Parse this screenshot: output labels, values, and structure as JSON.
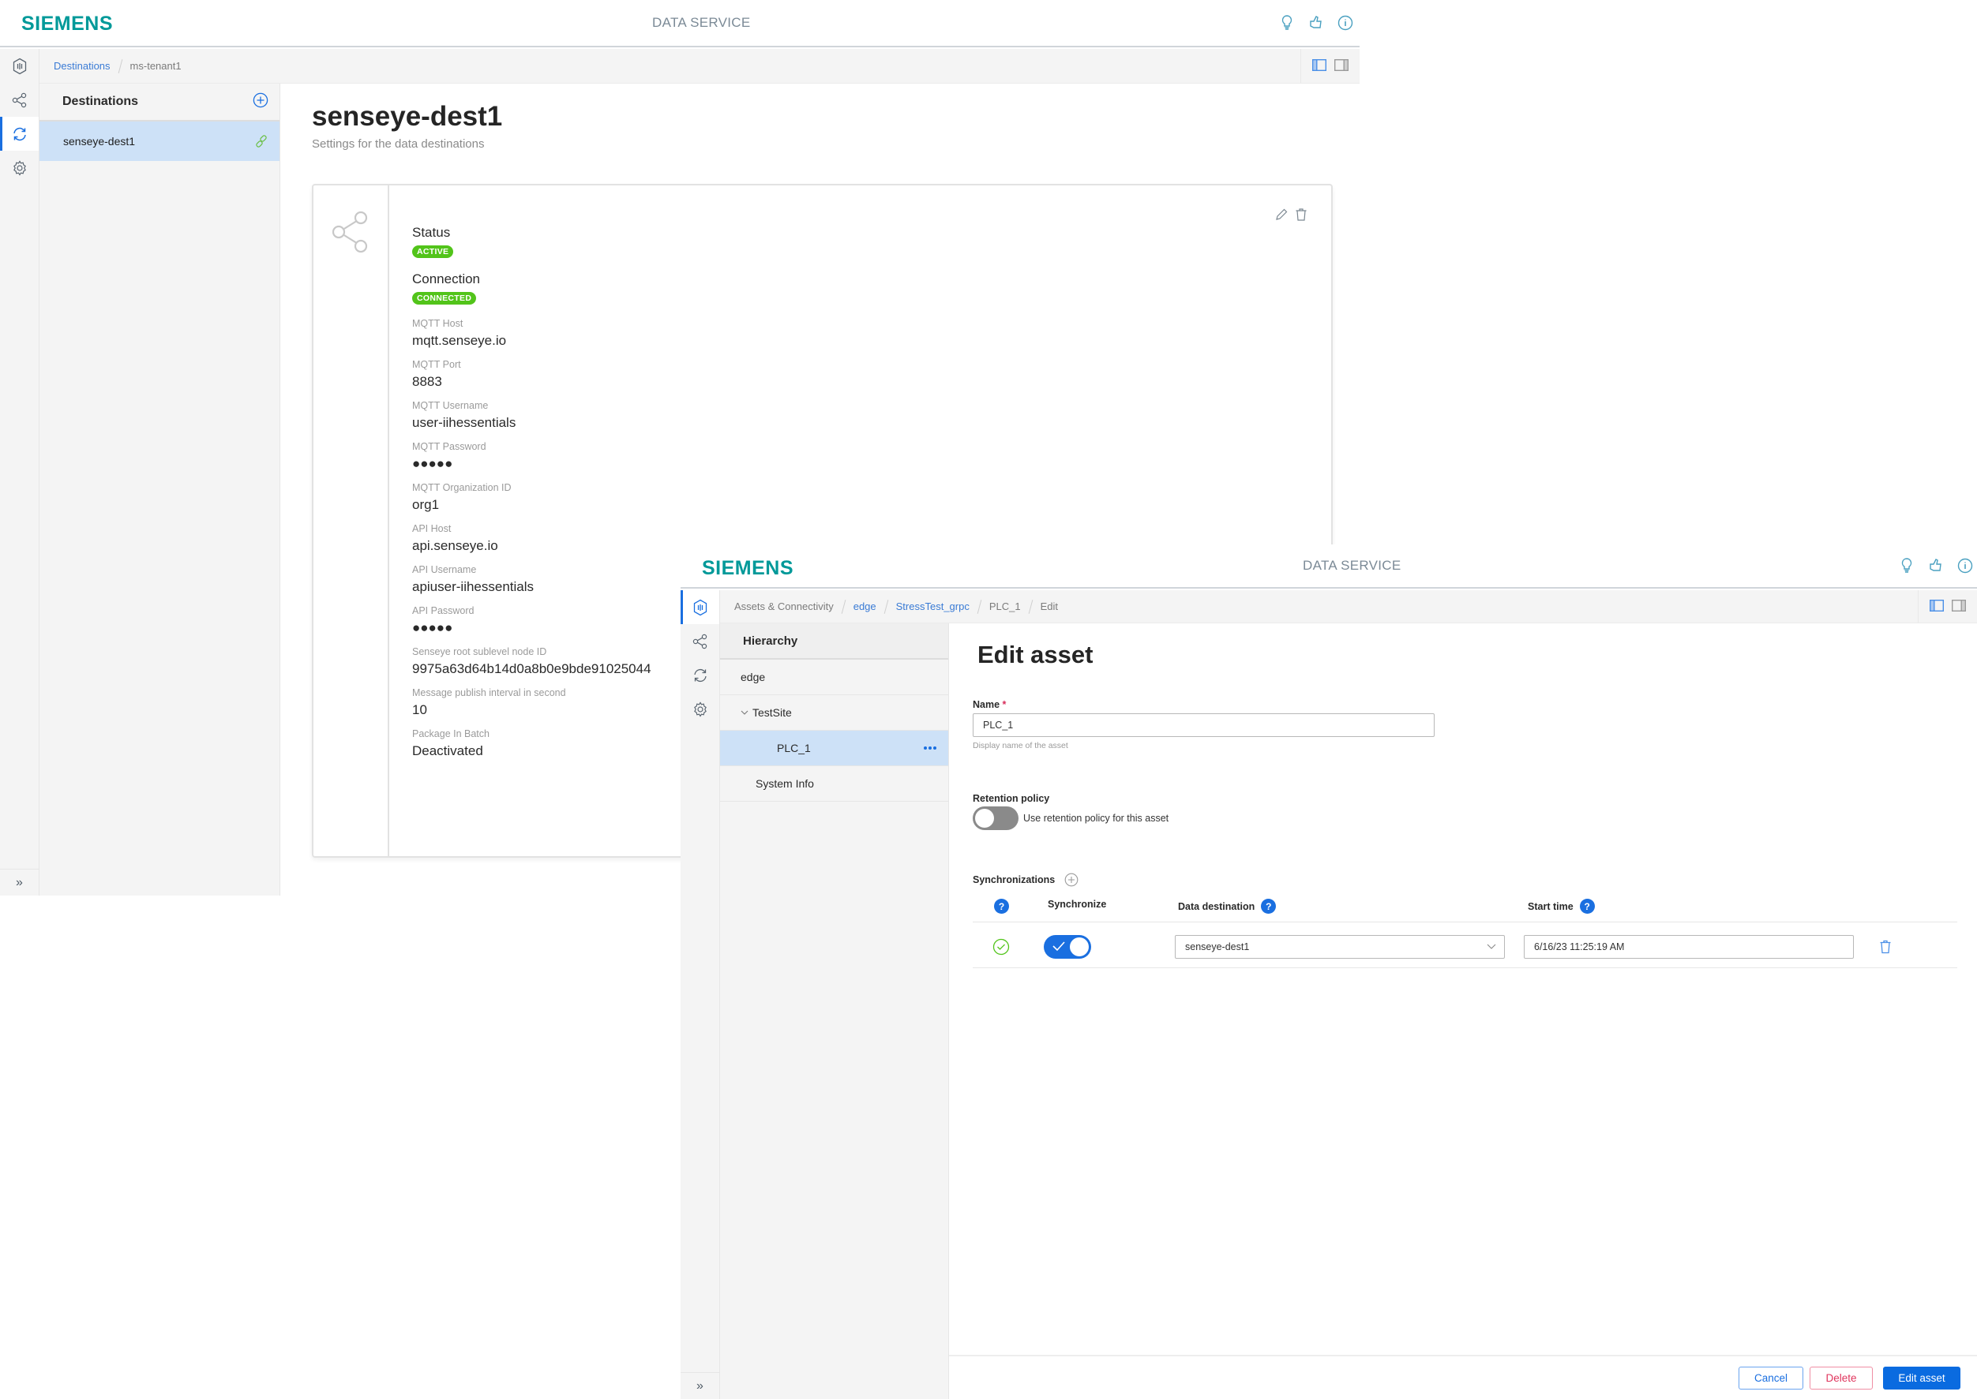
{
  "window1": {
    "header": {
      "logo": "SIEMENS",
      "app_title": "DATA SERVICE",
      "icons": [
        "lightbulb-icon",
        "feedback-icon",
        "info-icon"
      ]
    },
    "breadcrumb": [
      {
        "label": "Destinations",
        "link": true
      },
      {
        "label": "ms-tenant1",
        "link": false
      }
    ],
    "rail": [
      {
        "icon": "assets-icon",
        "active": false
      },
      {
        "icon": "share-icon",
        "active": false
      },
      {
        "icon": "sync-icon",
        "active": true
      },
      {
        "icon": "gear-icon",
        "active": false
      }
    ],
    "list": {
      "title": "Destinations",
      "items": [
        {
          "label": "senseye-dest1",
          "selected": true
        }
      ]
    },
    "detail": {
      "title": "senseye-dest1",
      "subtitle": "Settings for the data destinations",
      "status_label": "Status",
      "status_badge": "ACTIVE",
      "connection_label": "Connection",
      "connection_badge": "CONNECTED",
      "fields": [
        {
          "label": "MQTT Host",
          "value": "mqtt.senseye.io"
        },
        {
          "label": "MQTT Port",
          "value": "8883"
        },
        {
          "label": "MQTT Username",
          "value": "user-iihessentials"
        },
        {
          "label": "MQTT Password",
          "value": "●●●●●"
        },
        {
          "label": "MQTT Organization ID",
          "value": "org1"
        },
        {
          "label": "API Host",
          "value": "api.senseye.io"
        },
        {
          "label": "API Username",
          "value": "apiuser-iihessentials"
        },
        {
          "label": "API Password",
          "value": "●●●●●"
        },
        {
          "label": "Senseye root sublevel node ID",
          "value": "9975a63d64b14d0a8b0e9bde91025044"
        },
        {
          "label": "Message publish interval in second",
          "value": "10"
        },
        {
          "label": "Package In Batch",
          "value": "Deactivated"
        }
      ]
    }
  },
  "window2": {
    "header": {
      "logo": "SIEMENS",
      "app_title": "DATA SERVICE"
    },
    "breadcrumb": [
      {
        "label": "Assets & Connectivity",
        "link": false
      },
      {
        "label": "edge",
        "link": true
      },
      {
        "label": "StressTest_grpc",
        "link": true
      },
      {
        "label": "PLC_1",
        "link": false
      },
      {
        "label": "Edit",
        "link": false
      }
    ],
    "hierarchy": {
      "title": "Hierarchy",
      "items": [
        {
          "label": "edge",
          "level": 0
        },
        {
          "label": "TestSite",
          "level": 1,
          "expanded": true
        },
        {
          "label": "PLC_1",
          "level": 2,
          "selected": true
        },
        {
          "label": "System Info",
          "level": 1
        }
      ]
    },
    "form": {
      "title": "Edit asset",
      "name_label": "Name",
      "name_required": "*",
      "name_value": "PLC_1",
      "name_hint": "Display name of the asset",
      "retention_label": "Retention policy",
      "retention_toggle_label": "Use retention policy for this asset",
      "retention_enabled": false,
      "sync_title": "Synchronizations",
      "sync_columns": {
        "help": "?",
        "synchronize": "Synchronize",
        "destination": "Data destination",
        "start_time": "Start time"
      },
      "sync_rows": [
        {
          "state": "ok",
          "synchronize": true,
          "destination": "senseye-dest1",
          "start_time": "6/16/23 11:25:19 AM"
        }
      ]
    },
    "footer": {
      "cancel": "Cancel",
      "delete": "Delete",
      "submit": "Edit asset"
    }
  },
  "colors": {
    "brand": "#009999",
    "accent": "#1a6fe0",
    "success": "#52c41a",
    "danger": "#e0355d",
    "selected_bg": "#cde1f7"
  }
}
